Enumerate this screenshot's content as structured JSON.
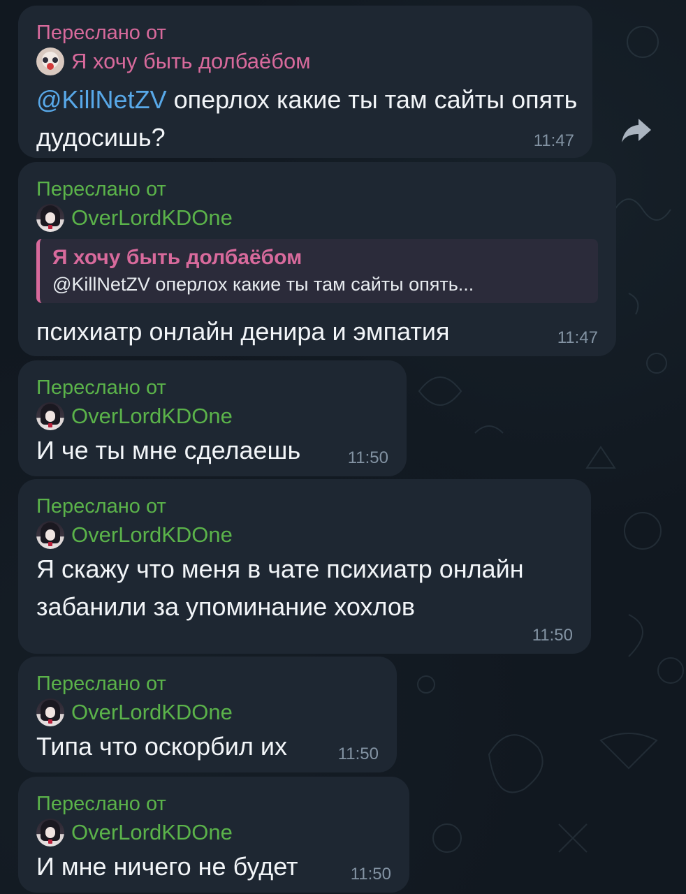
{
  "messages": [
    {
      "forwarded_label": "Переслано от",
      "author": "Я хочу быть долбаёбом",
      "mention": "@KillNetZV",
      "text": " оперлох какие ты там сайты опять дудосишь?",
      "time": "11:47"
    },
    {
      "forwarded_label": "Переслано от",
      "author": "OverLordKDOne",
      "reply": {
        "author": "Я хочу быть долбаёбом",
        "text": "@KillNetZV оперлох какие ты там сайты опять..."
      },
      "text": "психиатр онлайн денира и эмпатия",
      "time": "11:47"
    },
    {
      "forwarded_label": "Переслано от",
      "author": "OverLordKDOne",
      "text": "И че ты мне сделаешь",
      "time": "11:50"
    },
    {
      "forwarded_label": "Переслано от",
      "author": "OverLordKDOne",
      "text": "Я скажу что меня в чате психиатр онлайн забанили за упоминание хохлов",
      "time": "11:50"
    },
    {
      "forwarded_label": "Переслано от",
      "author": "OverLordKDOne",
      "text": "Типа что оскорбил их",
      "time": "11:50"
    },
    {
      "forwarded_label": "Переслано от",
      "author": "OverLordKDOne",
      "text": "И мне ничего не будет",
      "time": "11:50"
    }
  ],
  "icons": {
    "share": "share-arrow-icon",
    "avatar_1": "clown-avatar",
    "avatar_2": "anime-girl-avatar"
  },
  "colors": {
    "background": "#111820",
    "bubble": "#1e2732",
    "pink_author": "#d86a9c",
    "green_author": "#5bb34a",
    "mention": "#58a8e8",
    "time": "#8393a3"
  }
}
